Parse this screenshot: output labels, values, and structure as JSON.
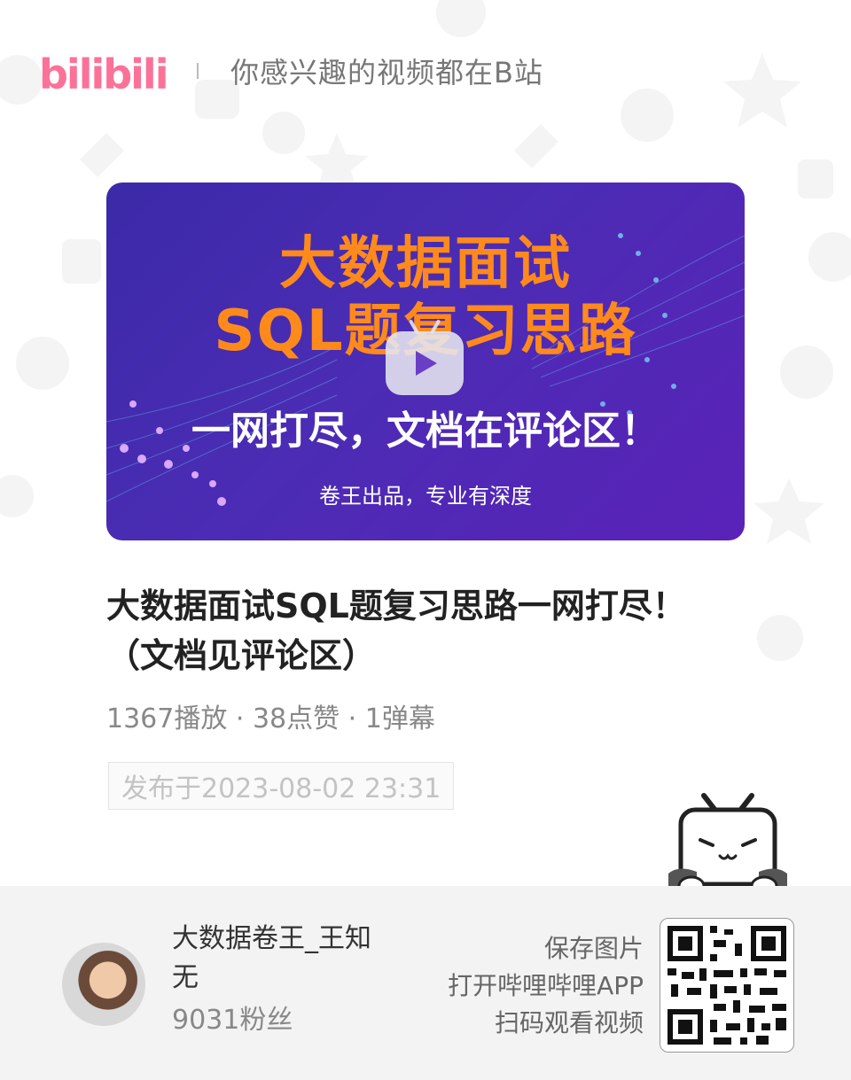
{
  "header": {
    "logo_text": "bilibili",
    "slogan": "你感兴趣的视频都在B站"
  },
  "cover": {
    "line1": "大数据面试",
    "line2": "SQL题复习思路",
    "line3": "一网打尽，文档在评论区！",
    "tagline": "卷王出品，专业有深度"
  },
  "video": {
    "title": "大数据面试SQL题复习思路一网打尽！（文档见评论区）",
    "stats": "1367播放 · 38点赞 · 1弹幕",
    "publish": "发布于2023-08-02 23:31"
  },
  "footer": {
    "author": "大数据卷王_王知无",
    "fans": "9031粉丝",
    "scan_lines": [
      "保存图片",
      "打开哔哩哔哩APP",
      "扫码观看视频"
    ]
  },
  "colors": {
    "brand_pink": "#fb7299",
    "cover_orange": "#ff8a1c",
    "cover_purple": "#4b2cb4"
  }
}
